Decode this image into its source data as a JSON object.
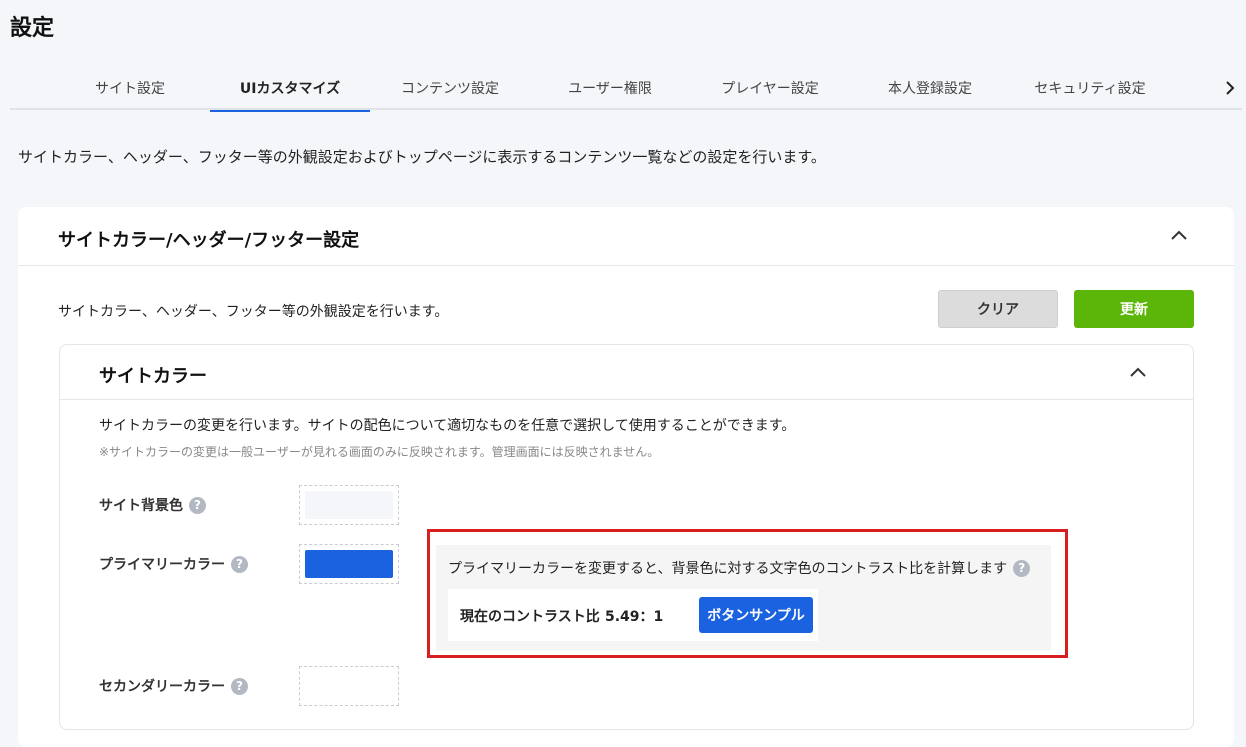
{
  "page": {
    "title": "設定"
  },
  "tabs": [
    {
      "label": "サイト設定",
      "active": false
    },
    {
      "label": "UIカスタマイズ",
      "active": true
    },
    {
      "label": "コンテンツ設定",
      "active": false
    },
    {
      "label": "ユーザー権限",
      "active": false
    },
    {
      "label": "プレイヤー設定",
      "active": false
    },
    {
      "label": "本人登録設定",
      "active": false
    },
    {
      "label": "セキュリティ設定",
      "active": false
    }
  ],
  "page_description": "サイトカラー、ヘッダー、フッター等の外観設定およびトップページに表示するコンテンツ一覧などの設定を行います。",
  "section": {
    "title": "サイトカラー/ヘッダー/フッター設定",
    "description": "サイトカラー、ヘッダー、フッター等の外観設定を行います。",
    "clear_label": "クリア",
    "update_label": "更新"
  },
  "site_color": {
    "title": "サイトカラー",
    "description": "サイトカラーの変更を行います。サイトの配色について適切なものを任意で選択して使用することができます。",
    "note": "※サイトカラーの変更は一般ユーザーが見れる画面のみに反映されます。管理画面には反映されません。",
    "background_label": "サイト背景色",
    "background_color": "#f4f6fa",
    "primary_label": "プライマリーカラー",
    "primary_color": "#1a62e0",
    "secondary_label": "セカンダリーカラー",
    "secondary_color": "#ffffff",
    "contrast_info": "プライマリーカラーを変更すると、背景色に対する文字色のコントラスト比を計算します",
    "contrast_label": "現在のコントラスト比",
    "contrast_value": "5.49：1",
    "sample_button_label": "ボタンサンプル"
  },
  "help_glyph": "?",
  "colors": {
    "accent": "#1a62e0",
    "update_button": "#5cb60a",
    "highlight": "#d71f1f"
  },
  "icons": [
    "chevron-right-icon",
    "chevron-up-icon",
    "help-icon"
  ]
}
